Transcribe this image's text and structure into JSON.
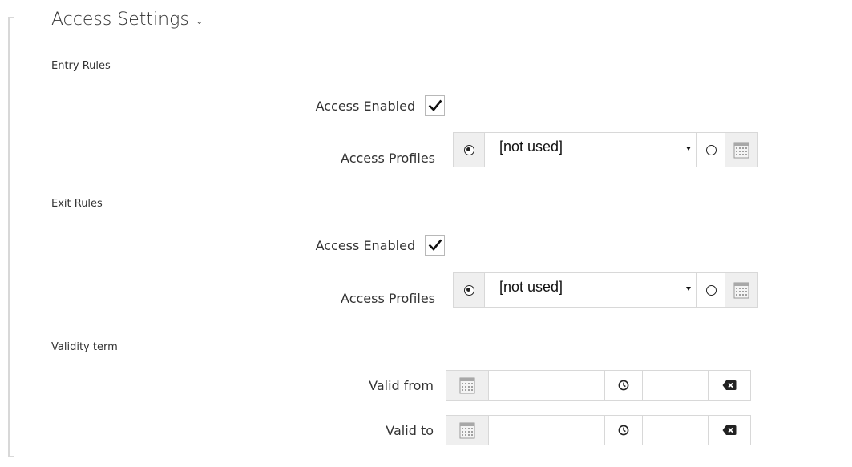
{
  "section": {
    "title": "Access Settings",
    "chevron": "chevron-down-icon"
  },
  "entry_rules": {
    "heading": "Entry Rules",
    "access_enabled": {
      "label": "Access Enabled",
      "checked": true
    },
    "access_profiles": {
      "label": "Access Profiles",
      "selected": "[not used]",
      "mode": "profile"
    }
  },
  "exit_rules": {
    "heading": "Exit Rules",
    "access_enabled": {
      "label": "Access Enabled",
      "checked": true
    },
    "access_profiles": {
      "label": "Access Profiles",
      "selected": "[not used]",
      "mode": "profile"
    }
  },
  "validity": {
    "heading": "Validity term",
    "valid_from": {
      "label": "Valid from",
      "date": "",
      "time": ""
    },
    "valid_to": {
      "label": "Valid to",
      "date": "",
      "time": ""
    }
  },
  "icons": {
    "checkbox": "checkmark-icon",
    "calendar": "calendar-icon",
    "clock": "clock-icon",
    "clear": "clear-input-icon",
    "dropdown": "caret-down-icon"
  },
  "colors": {
    "text": "#333333",
    "border": "#d8d8d8",
    "widget_bg": "#efefef"
  }
}
